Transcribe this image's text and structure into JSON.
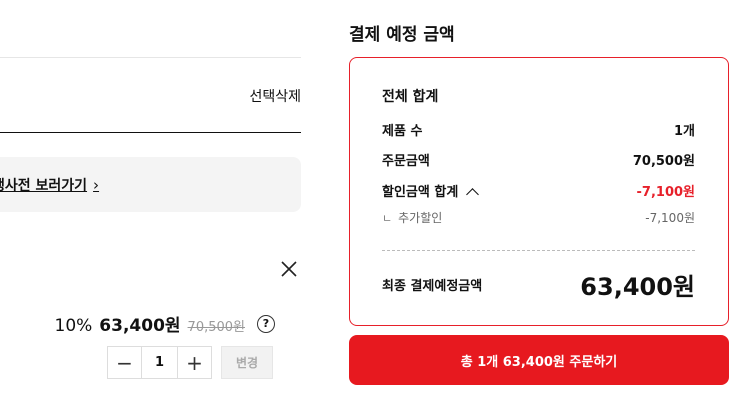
{
  "cart": {
    "select_delete_label": "선택삭제",
    "event_link_text": "행사전 보러가기",
    "event_link_chevron": "›",
    "item": {
      "discount_rate": "10%",
      "sale_price": "63,400원",
      "original_price": "70,500원",
      "help_icon": "?",
      "quantity": "1",
      "minus": "−",
      "plus": "+",
      "change_button": "변경"
    }
  },
  "summary": {
    "title": "결제 예정 금액",
    "total_header": "전체 합계",
    "product_count_label": "제품 수",
    "product_count_value": "1개",
    "order_amount_label": "주문금액",
    "order_amount_value": "70,500원",
    "discount_total_label": "할인금액 합계",
    "discount_total_value": "-7,100원",
    "extra_discount_mark": "ㄴ",
    "extra_discount_label": "추가할인",
    "extra_discount_value": "-7,100원",
    "final_label": "최종 결제예정금액",
    "final_value": "63,400원"
  },
  "order_button_label": "총 1개 63,400원 주문하기",
  "colors": {
    "accent_red": "#e7202a",
    "button_red": "#e7191f"
  }
}
